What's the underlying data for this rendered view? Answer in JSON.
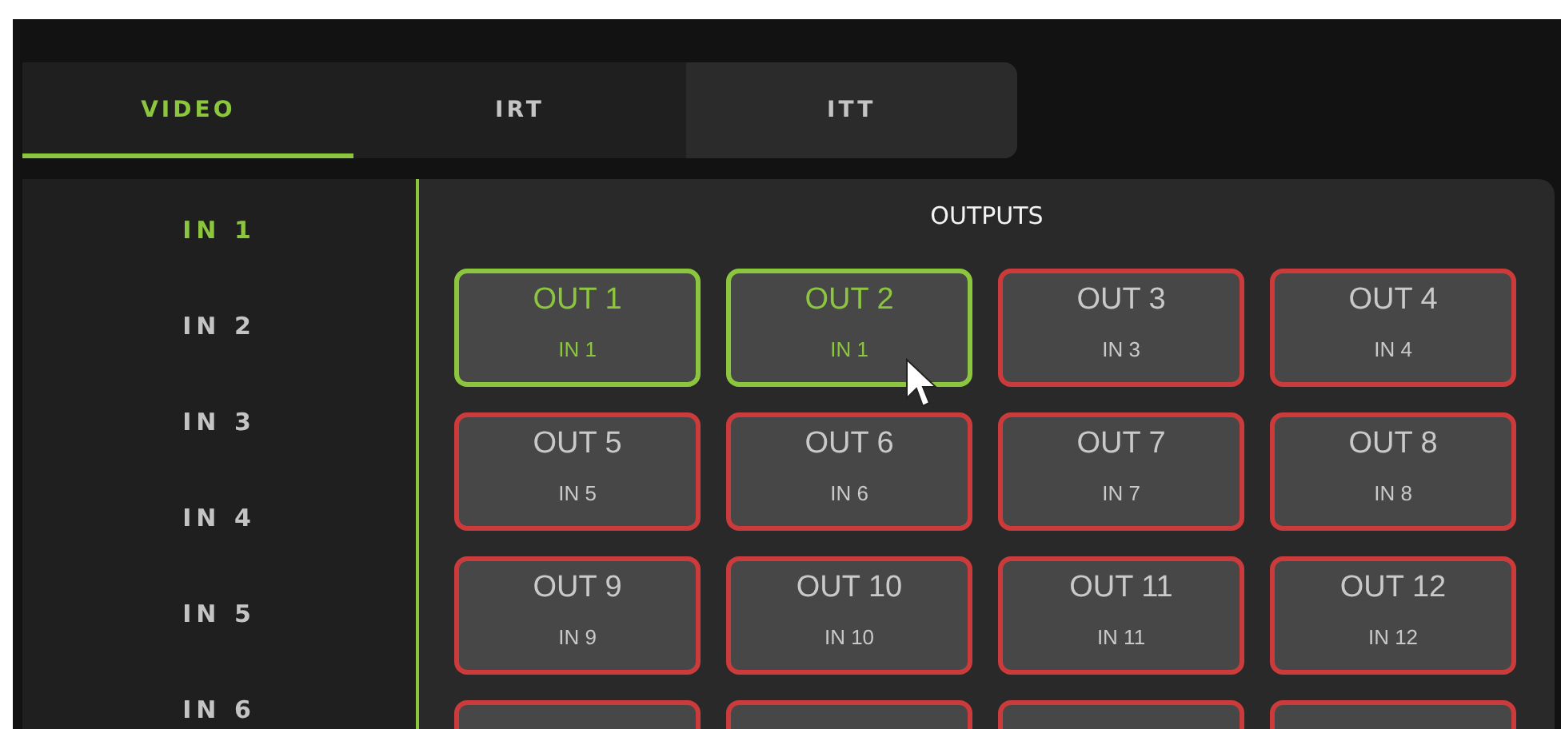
{
  "tabs": [
    {
      "label": "VIDEO",
      "selected": true,
      "highlighted": false
    },
    {
      "label": "IRT",
      "selected": false,
      "highlighted": false
    },
    {
      "label": "ITT",
      "selected": false,
      "highlighted": true
    }
  ],
  "inputs": [
    {
      "label": "IN 1",
      "selected": true
    },
    {
      "label": "IN 2",
      "selected": false
    },
    {
      "label": "IN 3",
      "selected": false
    },
    {
      "label": "IN 4",
      "selected": false
    },
    {
      "label": "IN 5",
      "selected": false
    },
    {
      "label": "IN 6",
      "selected": false
    }
  ],
  "outputs_panel": {
    "title": "OUTPUTS",
    "outputs": [
      {
        "name": "OUT 1",
        "source": "IN 1",
        "active": true
      },
      {
        "name": "OUT 2",
        "source": "IN 1",
        "active": true
      },
      {
        "name": "OUT 3",
        "source": "IN 3",
        "active": false
      },
      {
        "name": "OUT 4",
        "source": "IN 4",
        "active": false
      },
      {
        "name": "OUT 5",
        "source": "IN 5",
        "active": false
      },
      {
        "name": "OUT 6",
        "source": "IN 6",
        "active": false
      },
      {
        "name": "OUT 7",
        "source": "IN 7",
        "active": false
      },
      {
        "name": "OUT 8",
        "source": "IN 8",
        "active": false
      },
      {
        "name": "OUT 9",
        "source": "IN 9",
        "active": false
      },
      {
        "name": "OUT 10",
        "source": "IN 10",
        "active": false
      },
      {
        "name": "OUT 11",
        "source": "IN 11",
        "active": false
      },
      {
        "name": "OUT 12",
        "source": "IN 12",
        "active": false
      },
      {
        "active": false
      },
      {
        "active": false
      },
      {
        "active": false
      },
      {
        "active": false
      }
    ]
  }
}
